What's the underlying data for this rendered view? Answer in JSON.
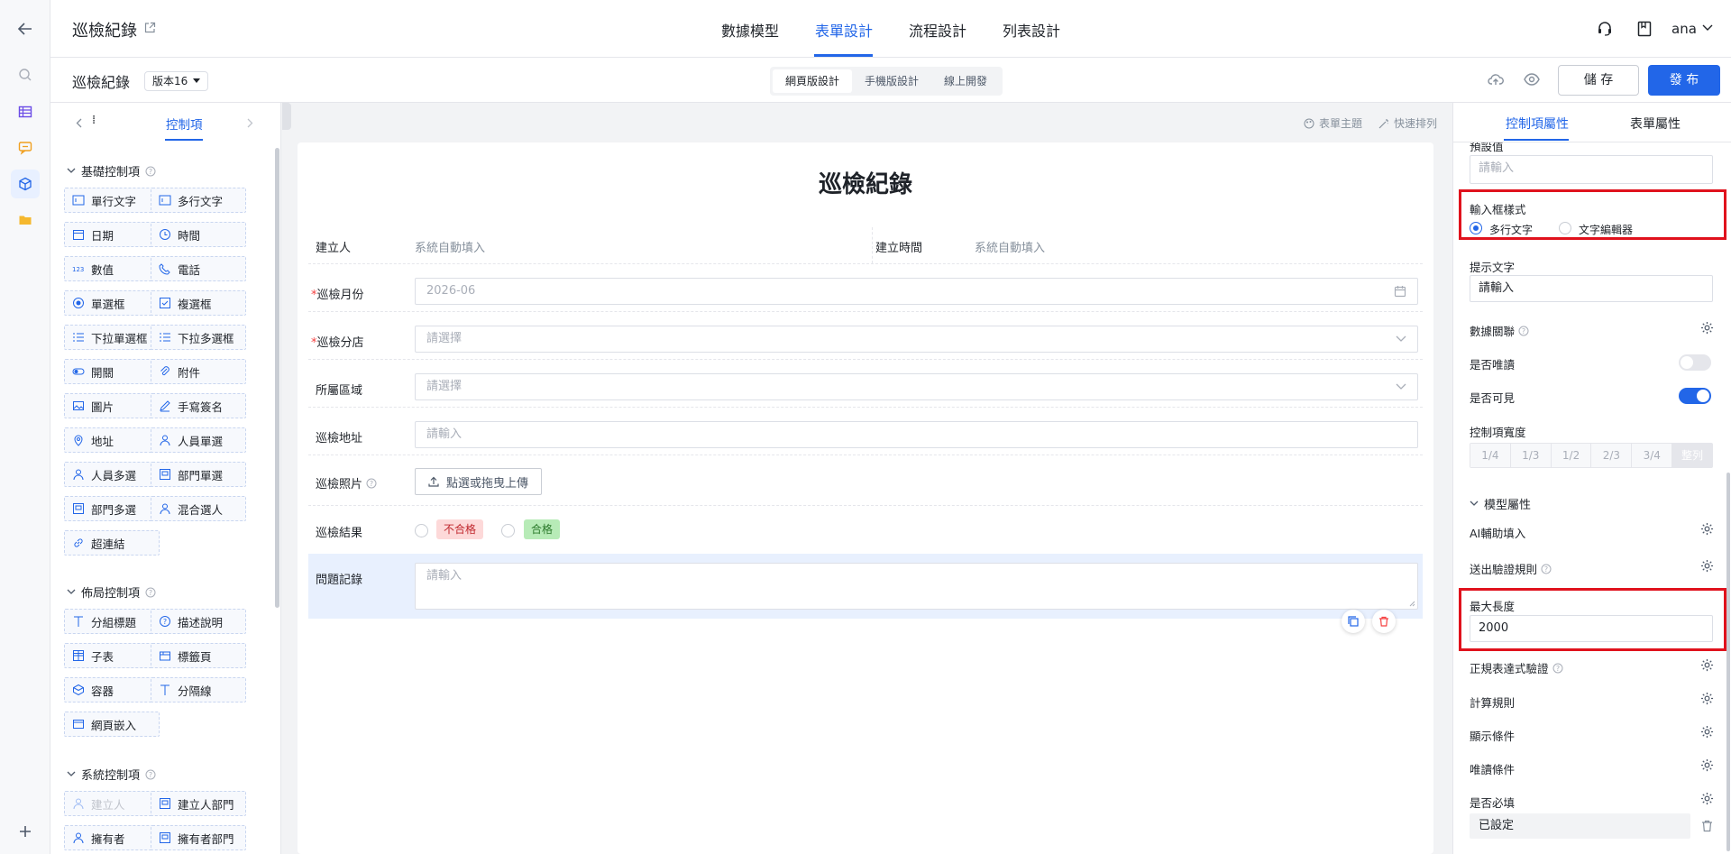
{
  "app": {
    "title": "巡檢紀錄",
    "user": "ana"
  },
  "top_tabs": [
    "數據模型",
    "表單設計",
    "流程設計",
    "列表設計"
  ],
  "subbar": {
    "form_name": "巡檢紀錄",
    "version": "版本16",
    "modes": [
      "網頁版設計",
      "手機版設計",
      "線上開發"
    ],
    "save": "儲 存",
    "publish": "發 布"
  },
  "left_panel": {
    "tab_icon_text": "⁞",
    "tab": "控制項",
    "sections": {
      "basic": "基礎控制項",
      "layout": "佈局控制項",
      "system": "系統控制項"
    },
    "basic_items": [
      "單行文字",
      "多行文字",
      "日期",
      "時間",
      "數值",
      "電話",
      "單選框",
      "複選框",
      "下拉單選框",
      "下拉多選框",
      "開關",
      "附件",
      "圖片",
      "手寫簽名",
      "地址",
      "人員單選",
      "人員多選",
      "部門單選",
      "部門多選",
      "混合選人",
      "超連結"
    ],
    "layout_items": [
      "分組標題",
      "描述說明",
      "子表",
      "標籤頁",
      "容器",
      "分隔線",
      "網頁嵌入"
    ],
    "system_items": [
      "建立人",
      "建立人部門",
      "擁有者",
      "擁有者部門"
    ]
  },
  "canvas": {
    "tools": [
      "表單主題",
      "快速排列"
    ],
    "form_title": "巡檢紀錄",
    "fields": {
      "creator_label": "建立人",
      "creator_value": "系統自動填入",
      "created_at_label": "建立時間",
      "created_at_value": "系統自動填入",
      "month_label": "巡檢月份",
      "month_value": "2026-06",
      "store_label": "巡檢分店",
      "store_placeholder": "請選擇",
      "region_label": "所屬區域",
      "region_placeholder": "請選擇",
      "address_label": "巡檢地址",
      "address_placeholder": "請輸入",
      "photo_label": "巡檢照片",
      "photo_button": "點選或拖曳上傳",
      "result_label": "巡檢結果",
      "result_bad": "不合格",
      "result_ok": "合格",
      "issue_label": "問題記錄",
      "issue_placeholder": "請輸入"
    }
  },
  "right_panel": {
    "tabs": [
      "控制項屬性",
      "表單屬性"
    ],
    "default_value_label": "預設值",
    "default_value_placeholder": "請輸入",
    "input_style_label": "輸入框樣式",
    "input_style_options": [
      "多行文字",
      "文字編輯器"
    ],
    "hint_label": "提示文字",
    "hint_value": "請輸入",
    "data_link_label": "數據關聯",
    "readonly_label": "是否唯讀",
    "readonly": false,
    "visible_label": "是否可見",
    "visible": true,
    "width_label": "控制項寬度",
    "width_options": [
      "1/4",
      "1/3",
      "1/2",
      "2/3",
      "3/4",
      "整列"
    ],
    "model_section": "模型屬性",
    "ai_fill_label": "AI輔助填入",
    "submit_rule_label": "送出驗證規則",
    "max_length_label": "最大長度",
    "max_length_value": "2000",
    "regex_label": "正規表達式驗證",
    "calc_label": "計算規則",
    "show_cond_label": "顯示條件",
    "readonly_cond_label": "唯讀條件",
    "required_label": "是否必填",
    "required_value": "已設定"
  },
  "colors": {
    "accent": "#2266e8",
    "highlight_box": "#e0121d",
    "canvas_bg": "#f2f3f5"
  }
}
